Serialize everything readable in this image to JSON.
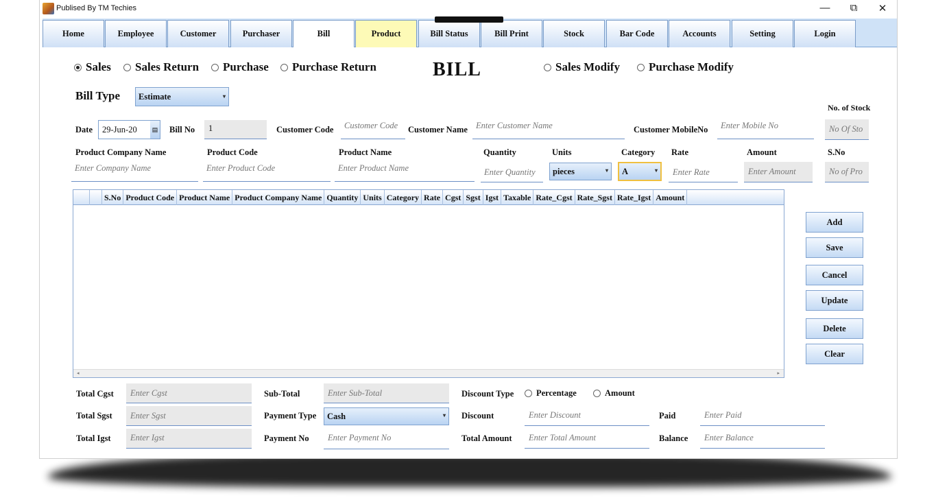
{
  "window": {
    "title": "Publised By TM Techies",
    "minimize": "—",
    "maximize": "⧉",
    "close": "✕"
  },
  "tabs": [
    "Home",
    "Employee",
    "Customer",
    "Purchaser",
    "Bill",
    "Product",
    "Bill Status",
    "Bill Print",
    "Stock",
    "Bar Code",
    "Accounts",
    "Setting",
    "Login"
  ],
  "mode": {
    "sales": "Sales",
    "sales_return": "Sales Return",
    "purchase": "Purchase",
    "purchase_return": "Purchase Return",
    "title": "BILL",
    "sales_modify": "Sales Modify",
    "purchase_modify": "Purchase Modify"
  },
  "bill_type": {
    "label": "Bill Type",
    "value": "Estimate"
  },
  "header": {
    "date_label": "Date",
    "date_value": "29-Jun-20",
    "billno_label": "Bill No",
    "billno_value": "1",
    "cust_code_label": "Customer Code",
    "cust_code_ph": "Customer Code",
    "cust_name_label": "Customer Name",
    "cust_name_ph": "Enter Customer Name",
    "cust_mobile_label": "Customer MobileNo",
    "cust_mobile_ph": "Enter Mobile No",
    "stock_label": "No. of Stock",
    "stock_ph": "No Of Sto"
  },
  "product": {
    "company_label": "Product Company Name",
    "company_ph": "Enter Company Name",
    "code_label": "Product Code",
    "code_ph": "Enter Product Code",
    "name_label": "Product Name",
    "name_ph": "Enter Product Name",
    "qty_label": "Quantity",
    "qty_ph": "Enter Quantity",
    "units_label": "Units",
    "units_value": "pieces",
    "category_label": "Category",
    "category_value": "A",
    "rate_label": "Rate",
    "rate_ph": "Enter Rate",
    "amount_label": "Amount",
    "amount_ph": "Enter Amount",
    "sno_label": "S.No",
    "sno_ph": "No of Pro"
  },
  "grid": {
    "columns": [
      "S.No",
      "Product Code",
      "Product Name",
      "Product Company Name",
      "Quantity",
      "Units",
      "Category",
      "Rate",
      "Cgst",
      "Sgst",
      "Igst",
      "Taxable",
      "Rate_Cgst",
      "Rate_Sgst",
      "Rate_Igst",
      "Amount"
    ],
    "scroll_left": "◂",
    "scroll_right": "▸"
  },
  "actions": [
    "Add",
    "Save",
    "Cancel",
    "Update",
    "Delete",
    "Clear"
  ],
  "footer": {
    "total_cgst_label": "Total Cgst",
    "total_cgst_ph": "Enter Cgst",
    "total_sgst_label": "Total Sgst",
    "total_sgst_ph": "Enter Sgst",
    "total_igst_label": "Total Igst",
    "total_igst_ph": "Enter Igst",
    "subtotal_label": "Sub-Total",
    "subtotal_ph": "Enter Sub-Total",
    "payment_type_label": "Payment Type",
    "payment_type_value": "Cash",
    "payment_no_label": "Payment No",
    "payment_no_ph": "Enter Payment No",
    "discount_type_label": "Discount Type",
    "percentage": "Percentage",
    "amount": "Amount",
    "discount_label": "Discount",
    "discount_ph": "Enter Discount",
    "total_amount_label": "Total Amount",
    "total_amount_ph": "Enter Total Amount",
    "paid_label": "Paid",
    "paid_ph": "Enter Paid",
    "balance_label": "Balance",
    "balance_ph": "Enter Balance"
  }
}
